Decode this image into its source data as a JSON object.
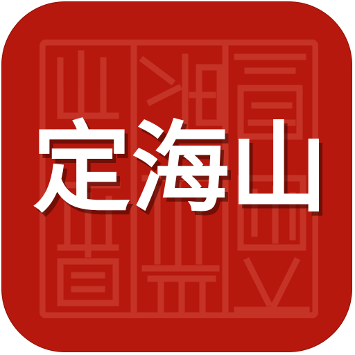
{
  "app_icon": {
    "name_text": "定海山",
    "seal_text": "",
    "colors": {
      "background": "#b6180d",
      "seal_lines": "#d24a3c",
      "text": "#ffffff",
      "text_shadow": "#3a0702"
    }
  }
}
